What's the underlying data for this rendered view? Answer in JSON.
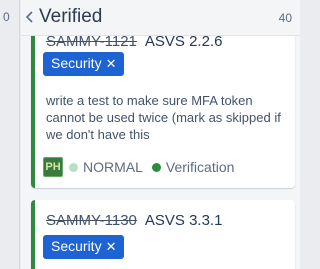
{
  "board": {
    "prev_column_count": "0"
  },
  "column": {
    "title": "Verified",
    "count": "40"
  },
  "cards": [
    {
      "key": "SAMMY-1121",
      "reference": "ASVS 2.2.6",
      "tag": "Security",
      "summary": "write a test to make sure MFA token cannot be used twice (mark as skipped if we don't have this",
      "avatar": "PH",
      "priority": "NORMAL",
      "status": "Verification"
    },
    {
      "key": "SAMMY-1130",
      "reference": "ASVS 3.3.1",
      "tag": "Security"
    }
  ],
  "colors": {
    "card_accent": "#2e8b3e",
    "tag_background": "#1d63d4",
    "priority_dot": "#b8e0c0",
    "status_dot": "#2e8b3e"
  },
  "icons": {
    "collapse": "chevron-left-icon",
    "remove_tag": "close-icon"
  }
}
